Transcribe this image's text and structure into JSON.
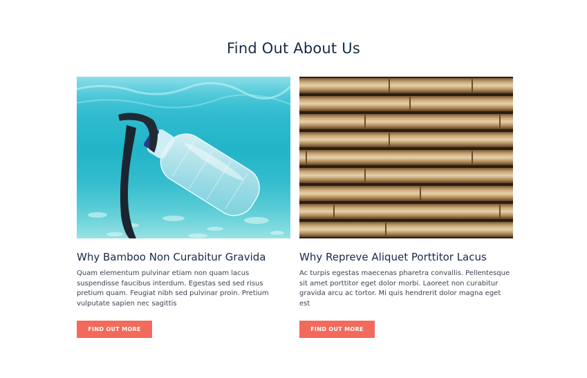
{
  "section": {
    "title": "Find Out About Us"
  },
  "cards": [
    {
      "image": "plastic-bottle-underwater",
      "title": "Why Bamboo Non Curabitur Gravida",
      "body": "Quam elementum pulvinar etiam non quam lacus suspendisse faucibus interdum. Egestas sed sed risus pretium quam. Feugiat nibh sed pulvinar proin. Pretium vulputate sapien nec sagittis",
      "button_label": "FIND OUT MORE"
    },
    {
      "image": "bamboo-stalks",
      "title": "Why Repreve Aliquet Porttitor Lacus",
      "body": "Ac turpis egestas maecenas pharetra convallis. Pellentesque sit amet porttitor eget dolor morbi. Laoreet non curabitur gravida arcu ac tortor. Mi quis hendrerit dolor magna eget est",
      "button_label": "FIND OUT MORE"
    }
  ],
  "colors": {
    "heading": "#17294a",
    "button": "#f26a5b",
    "button_text": "#ffffff"
  }
}
